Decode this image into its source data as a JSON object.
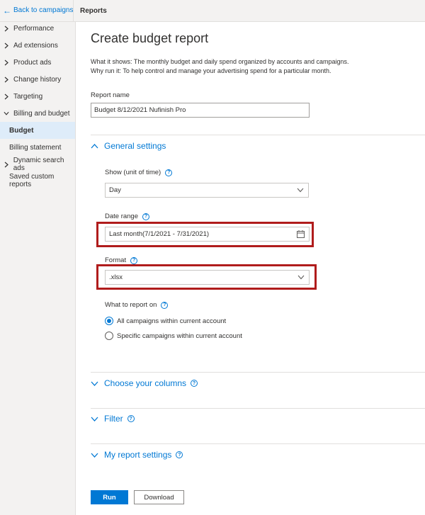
{
  "topbar": {
    "back_label": "Back to campaigns",
    "tab_label": "Reports"
  },
  "sidebar": {
    "items": [
      {
        "label": "Performance",
        "chevron": "right"
      },
      {
        "label": "Ad extensions",
        "chevron": "right"
      },
      {
        "label": "Product ads",
        "chevron": "right"
      },
      {
        "label": "Change history",
        "chevron": "right"
      },
      {
        "label": "Targeting",
        "chevron": "right"
      },
      {
        "label": "Billing and budget",
        "chevron": "down"
      },
      {
        "label": "Budget",
        "active": true
      },
      {
        "label": "Billing statement"
      },
      {
        "label": "Dynamic search ads",
        "chevron": "right"
      },
      {
        "label": "Saved custom reports"
      }
    ]
  },
  "main": {
    "title": "Create budget report",
    "description_line1": "What it shows: The monthly budget and daily spend organized by accounts and campaigns.",
    "description_line2": "Why run it: To help control and manage your advertising spend for a particular month.",
    "report_name_label": "Report name",
    "report_name_value": "Budget 8/12/2021 Nufinish Pro",
    "general_settings": {
      "title": "General settings",
      "show_label": "Show (unit of time)",
      "show_value": "Day",
      "date_range_label": "Date range",
      "date_range_value": "Last month(7/1/2021 - 7/31/2021)",
      "format_label": "Format",
      "format_value": ".xlsx",
      "report_on_label": "What to report on",
      "report_on_options": [
        {
          "label": "All campaigns within current account",
          "checked": true
        },
        {
          "label": "Specific campaigns within current account",
          "checked": false
        }
      ]
    },
    "sections": [
      {
        "title": "Choose your columns"
      },
      {
        "title": "Filter"
      },
      {
        "title": "My report settings"
      }
    ],
    "run_label": "Run",
    "download_label": "Download"
  },
  "colors": {
    "accent": "#0078d4",
    "highlight": "#b01c1c",
    "sidebar_bg": "#f3f2f1",
    "active_bg": "#deecf9"
  },
  "icons": [
    "arrow-left-icon",
    "chevron-right-icon",
    "chevron-down-icon",
    "chevron-up-icon",
    "calendar-icon",
    "help-icon"
  ]
}
